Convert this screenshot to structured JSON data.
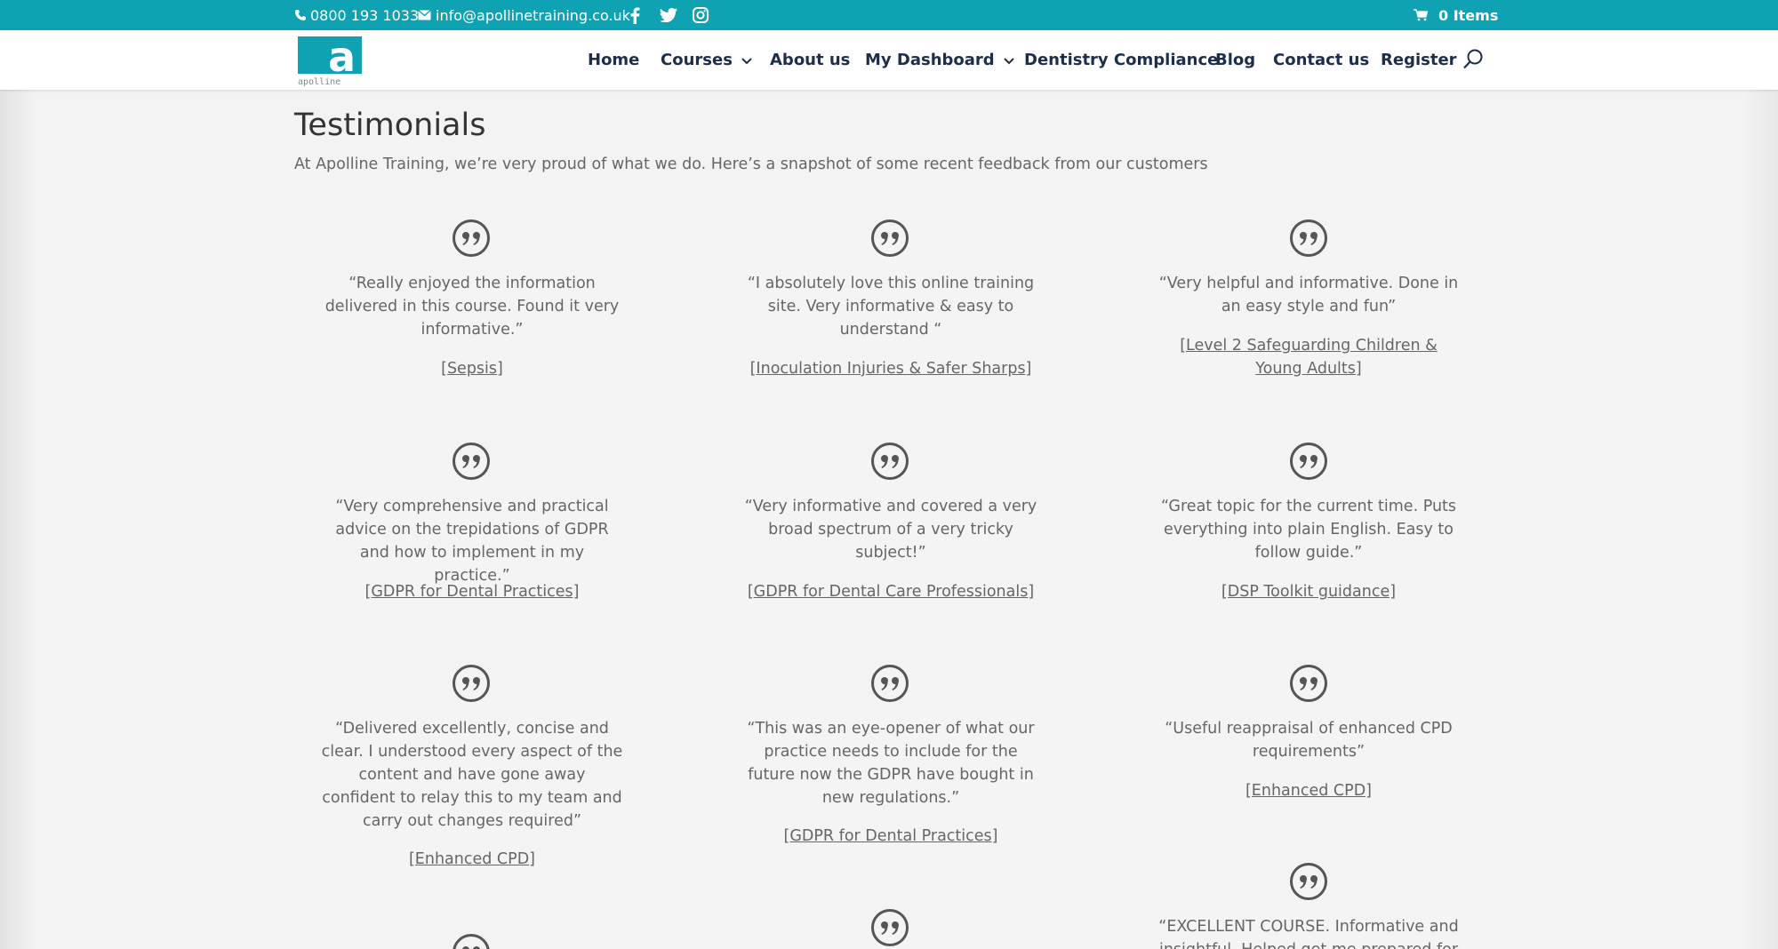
{
  "topbar": {
    "phone": "0800 193 1033",
    "email": "info@apollinetraining.co.uk",
    "social_icons": [
      "facebook-icon",
      "twitter-icon",
      "instagram-icon"
    ],
    "cart": "0 Items",
    "bg_color": "#0ea2b3"
  },
  "header": {
    "logo_text": "apolline",
    "nav": [
      {
        "label": "Home"
      },
      {
        "label": "Courses",
        "has_dropdown": true
      },
      {
        "label": "About us"
      },
      {
        "label": "My Dashboard",
        "has_dropdown": true
      },
      {
        "label": "Dentistry Compliance"
      },
      {
        "label": "Blog"
      },
      {
        "label": "Contact us"
      },
      {
        "label": "Register"
      }
    ]
  },
  "main": {
    "title": "Testimonials",
    "intro": "At Apolline Training, we’re very proud of what we do. Here’s a snapshot of some recent feedback from our customers",
    "testimonials": [
      {
        "quote": "“Really enjoyed the information delivered in this course. Found it very informative.”",
        "course": "[Sepsis]"
      },
      {
        "quote": "“I absolutely love this online training site. Very informative & easy to understand “",
        "course": "[Inoculation Injuries & Safer Sharps]"
      },
      {
        "quote": "“Very helpful and informative. Done in an easy style and fun”",
        "course": "[Level 2 Safeguarding Children & Young Adults]"
      },
      {
        "quote": "“Very comprehensive and practical advice on the trepidations of GDPR and how to implement in my practice.”",
        "course": "[GDPR for Dental Practices]"
      },
      {
        "quote": "“Very informative and covered a very broad spectrum of a very tricky subject!”",
        "course": "[GDPR for Dental Care Professionals]"
      },
      {
        "quote": "“Great topic for the current time. Puts everything into plain English. Easy to follow guide.”",
        "course": "[DSP Toolkit guidance]"
      },
      {
        "quote": "“Delivered excellently, concise and clear. I understood every aspect of the content and have gone away confident to relay this to my team and carry out changes required”",
        "course": "[Enhanced CPD]"
      },
      {
        "quote": "“This was an eye-opener of what our practice needs to include for the future now the GDPR have bought in new regulations.”",
        "course": "[GDPR for Dental Practices]"
      },
      {
        "quote": "“Useful reappraisal of enhanced CPD requirements”",
        "course": "[Enhanced CPD]"
      },
      {
        "quote": "“EXCELLENT COURSE. Informative and insightful. Helped get me prepared for"
      }
    ]
  },
  "colors": {
    "accent": "#0ea2b3",
    "nav_text": "#1d2e4a",
    "body_text": "#666666",
    "card_bg": "#f4f4f4"
  }
}
